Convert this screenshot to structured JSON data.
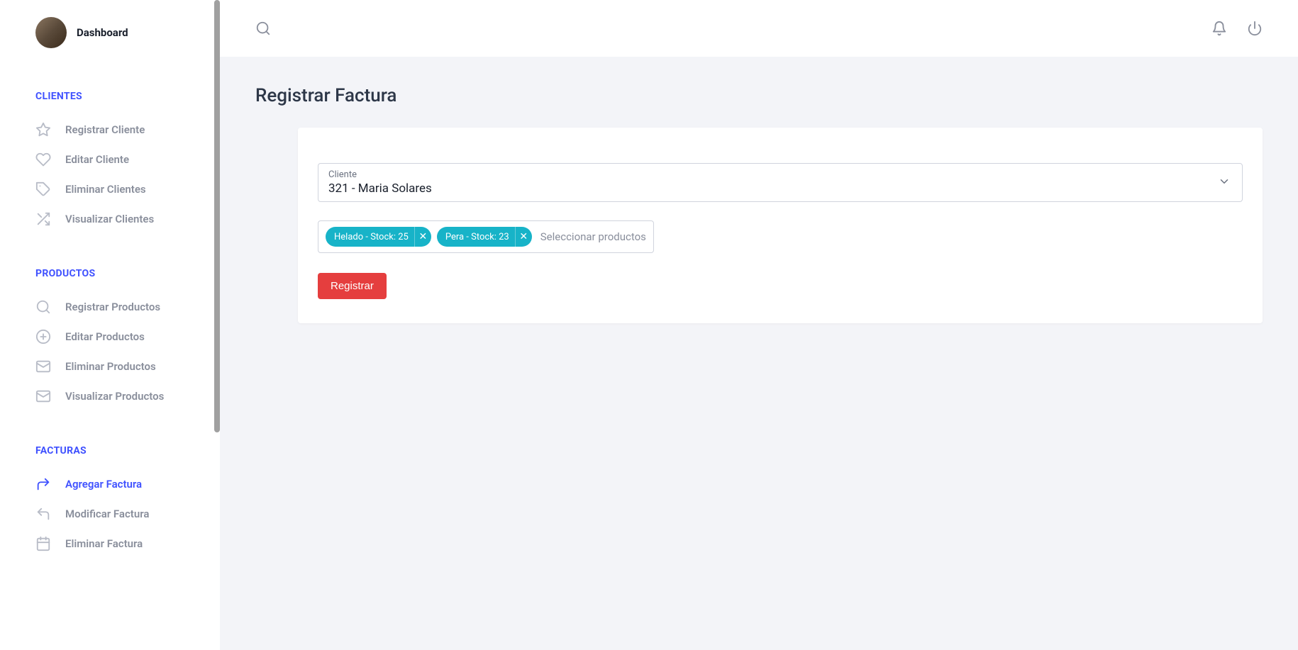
{
  "sidebar": {
    "title": "Dashboard",
    "sections": [
      {
        "header": "CLIENTES",
        "items": [
          {
            "label": "Registrar Cliente",
            "icon": "star",
            "active": false
          },
          {
            "label": "Editar Cliente",
            "icon": "heart",
            "active": false
          },
          {
            "label": "Eliminar Clientes",
            "icon": "tag",
            "active": false
          },
          {
            "label": "Visualizar Clientes",
            "icon": "shuffle",
            "active": false
          }
        ]
      },
      {
        "header": "PRODUCTOS",
        "items": [
          {
            "label": "Registrar Productos",
            "icon": "search",
            "active": false
          },
          {
            "label": "Editar Productos",
            "icon": "plus-circle",
            "active": false
          },
          {
            "label": "Eliminar Productos",
            "icon": "mail",
            "active": false
          },
          {
            "label": "Visualizar Productos",
            "icon": "mail",
            "active": false
          }
        ]
      },
      {
        "header": "FACTURAS",
        "items": [
          {
            "label": "Agregar Factura",
            "icon": "redo",
            "active": true
          },
          {
            "label": "Modificar Factura",
            "icon": "undo",
            "active": false
          },
          {
            "label": "Eliminar Factura",
            "icon": "calendar",
            "active": false
          }
        ]
      }
    ]
  },
  "page": {
    "title": "Registrar Factura"
  },
  "form": {
    "client_label": "Cliente",
    "client_value": "321 - Maria Solares",
    "products_placeholder": "Seleccionar productos",
    "chips": [
      {
        "label": "Helado - Stock: 25"
      },
      {
        "label": "Pera - Stock: 23"
      }
    ],
    "submit_label": "Registrar"
  }
}
